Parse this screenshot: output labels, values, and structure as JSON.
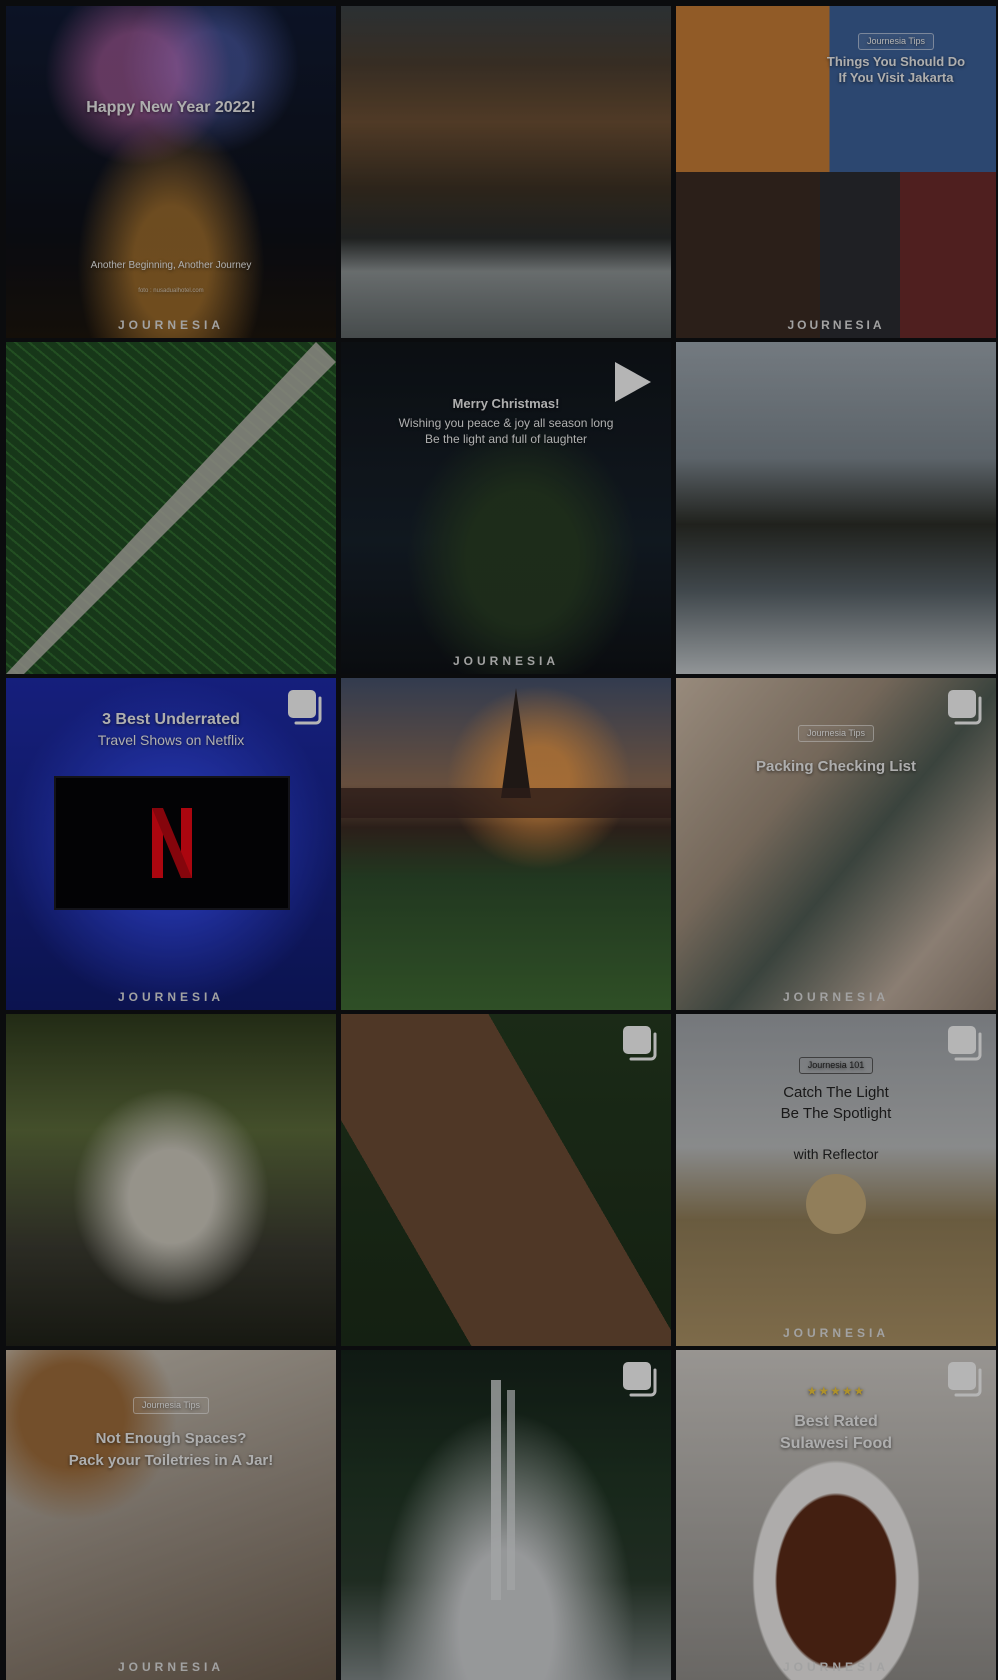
{
  "brand": "JOURNESIA",
  "tiles": [
    {
      "caption_title": "Happy New Year 2022!",
      "caption_sub": "Another Beginning, Another Journey",
      "credit": "foto : nusadualhotel.com",
      "brand": "JOURNESIA"
    },
    {
      "caption_title": "",
      "caption_sub": ""
    },
    {
      "pill": "Journesia Tips",
      "caption_title": "Things You Should Do If You Visit Jakarta",
      "brand": "JOURNESIA"
    },
    {
      "caption_title": "",
      "caption_sub": ""
    },
    {
      "caption_title": "Merry Christmas!",
      "caption_sub": "Wishing you peace & joy all season long",
      "caption_sub2": "Be the light and full of laughter",
      "brand": "JOURNESIA",
      "type": "video"
    },
    {
      "caption_title": "",
      "caption_sub": ""
    },
    {
      "caption_title": "3 Best Underrated",
      "caption_sub": "Travel Shows on Netflix",
      "brand": "JOURNESIA",
      "type": "carousel"
    },
    {
      "caption_title": "",
      "caption_sub": ""
    },
    {
      "pill": "Journesia Tips",
      "caption_title": "Packing Checking List",
      "brand": "JOURNESIA",
      "type": "carousel"
    },
    {
      "caption_title": "",
      "caption_sub": ""
    },
    {
      "caption_title": "",
      "caption_sub": "",
      "type": "carousel"
    },
    {
      "pill": "Journesia 101",
      "caption_title": "Catch The Light",
      "caption_sub": "Be The Spotlight",
      "caption_sub2": "with Reflector",
      "brand": "JOURNESIA",
      "type": "carousel"
    },
    {
      "pill": "Journesia Tips",
      "caption_title": "Not Enough Spaces?",
      "caption_sub": "Pack your Toiletries in A Jar!",
      "brand": "JOURNESIA"
    },
    {
      "caption_title": "",
      "caption_sub": "",
      "type": "carousel"
    },
    {
      "caption_title": "Best Rated",
      "caption_sub": "Sulawesi Food",
      "brand": "JOURNESIA",
      "type": "carousel"
    }
  ],
  "icons": {
    "carousel": "multiple-posts-icon",
    "video": "play-icon",
    "netflix": "netflix-logo-icon"
  }
}
